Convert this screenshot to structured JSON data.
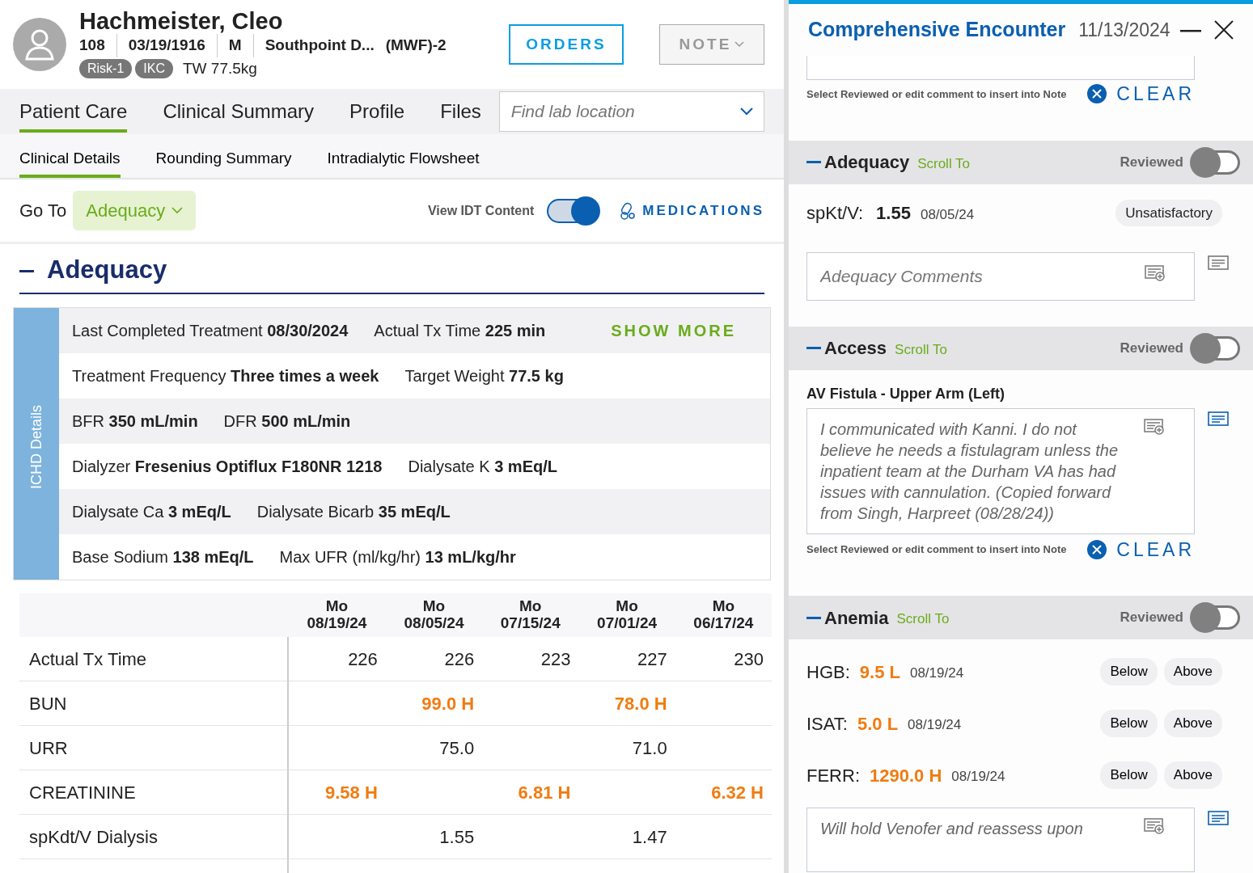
{
  "patient": {
    "name": "Hachmeister, Cleo",
    "details": [
      "108",
      "03/19/1916",
      "M",
      "Southpoint D...",
      "(MWF)-2"
    ],
    "badges": [
      "Risk-1",
      "IKC"
    ],
    "weight": "TW 77.5kg"
  },
  "header_buttons": {
    "orders": "ORDERS",
    "note": "NOTE"
  },
  "tabs": [
    {
      "label": "Patient Care",
      "selected": true
    },
    {
      "label": "Clinical Summary",
      "selected": false
    },
    {
      "label": "Profile",
      "selected": false
    },
    {
      "label": "Files",
      "selected": false
    }
  ],
  "lab_location": {
    "placeholder": "Find lab location"
  },
  "subtabs": [
    {
      "label": "Clinical Details",
      "selected": true
    },
    {
      "label": "Rounding Summary",
      "selected": false
    },
    {
      "label": "Intradialytic Flowsheet",
      "selected": false
    }
  ],
  "goto": {
    "label": "Go To",
    "value": "Adequacy"
  },
  "idt_toggle": {
    "label": "View IDT Content",
    "on": true
  },
  "medications": "MEDICATIONS",
  "section": {
    "title": "Adequacy",
    "expanded": true
  },
  "ichd": {
    "side_label": "ICHD Details",
    "show_more": "SHOW MORE",
    "rows": [
      [
        {
          "label": "Last Completed Treatment",
          "value": "08/30/2024"
        },
        {
          "label": "Actual Tx Time",
          "value": "225 min"
        }
      ],
      [
        {
          "label": "Treatment Frequency",
          "value": "Three times a week"
        },
        {
          "label": "Target Weight",
          "value": "77.5 kg"
        }
      ],
      [
        {
          "label": "BFR",
          "value": "350 mL/min"
        },
        {
          "label": "DFR",
          "value": "500 mL/min"
        }
      ],
      [
        {
          "label": "Dialyzer",
          "value": "Fresenius Optiflux F180NR 1218"
        },
        {
          "label": "Dialysate K",
          "value": "3 mEq/L"
        }
      ],
      [
        {
          "label": "Dialysate Ca",
          "value": "3 mEq/L"
        },
        {
          "label": "Dialysate Bicarb",
          "value": "35 mEq/L"
        }
      ],
      [
        {
          "label": "Base Sodium",
          "value": "138 mEq/L"
        },
        {
          "label": "Max UFR (ml/kg/hr)",
          "value": "13 mL/kg/hr"
        }
      ]
    ]
  },
  "flow_table": {
    "columns": [
      {
        "day": "Mo",
        "date": "08/19/24"
      },
      {
        "day": "Mo",
        "date": "08/05/24"
      },
      {
        "day": "Mo",
        "date": "07/15/24"
      },
      {
        "day": "Mo",
        "date": "07/01/24"
      },
      {
        "day": "Mo",
        "date": "06/17/24"
      }
    ],
    "rows": [
      {
        "label": "Actual Tx Time",
        "cells": [
          {
            "text": "226",
            "abnormal": false
          },
          {
            "text": "226",
            "abnormal": false
          },
          {
            "text": "223",
            "abnormal": false
          },
          {
            "text": "227",
            "abnormal": false
          },
          {
            "text": "230",
            "abnormal": false
          }
        ]
      },
      {
        "label": "BUN",
        "cells": [
          null,
          {
            "text": "99.0 H",
            "abnormal": true
          },
          null,
          {
            "text": "78.0 H",
            "abnormal": true
          },
          null
        ]
      },
      {
        "label": "URR",
        "cells": [
          null,
          {
            "text": "75.0",
            "abnormal": false
          },
          null,
          {
            "text": "71.0",
            "abnormal": false
          },
          null
        ]
      },
      {
        "label": "CREATININE",
        "cells": [
          {
            "text": "9.58 H",
            "abnormal": true
          },
          null,
          {
            "text": "6.81 H",
            "abnormal": true
          },
          null,
          {
            "text": "6.32 H",
            "abnormal": true
          }
        ]
      },
      {
        "label": "spKdt/V Dialysis",
        "cells": [
          null,
          {
            "text": "1.55",
            "abnormal": false
          },
          null,
          {
            "text": "1.47",
            "abnormal": false
          },
          null
        ]
      }
    ]
  },
  "encounter": {
    "title": "Comprehensive Encounter",
    "date": "11/13/2024",
    "top_hint": "Select Reviewed or edit comment to insert into Note",
    "top_clear": "CLEAR",
    "sections": [
      {
        "kind": "adequacy",
        "title": "Adequacy",
        "scroll_to": "Scroll To",
        "reviewed_label": "Reviewed",
        "reviewed": false,
        "result": {
          "label": "spKt/V:",
          "value": "1.55",
          "date": "08/05/24",
          "status": "Unsatisfactory"
        },
        "comment": {
          "placeholder": "Adequacy Comments"
        }
      },
      {
        "kind": "access",
        "title": "Access",
        "scroll_to": "Scroll To",
        "reviewed_label": "Reviewed",
        "reviewed": false,
        "subtitle": "AV Fistula - Upper Arm (Left)",
        "comment": {
          "value": "I communicated with Kanni. I do not believe he needs a fistulagram unless the inpatient team at the Durham VA has had issues with cannulation. (Copied forward from Singh, Harpreet (08/28/24))"
        },
        "hint": "Select Reviewed or edit comment to insert into Note",
        "clear": "CLEAR"
      },
      {
        "kind": "anemia",
        "title": "Anemia",
        "scroll_to": "Scroll To",
        "reviewed_label": "Reviewed",
        "reviewed": false,
        "labs": [
          {
            "label": "HGB:",
            "value": "9.5 L",
            "date": "08/19/24",
            "options": [
              "Below",
              "Above"
            ]
          },
          {
            "label": "ISAT:",
            "value": "5.0 L",
            "date": "08/19/24",
            "options": [
              "Below",
              "Above"
            ]
          },
          {
            "label": "FERR:",
            "value": "1290.0 H",
            "date": "08/19/24",
            "options": [
              "Below",
              "Above"
            ]
          }
        ],
        "comment": {
          "value": "Will hold Venofer and reassess upon"
        }
      }
    ]
  }
}
